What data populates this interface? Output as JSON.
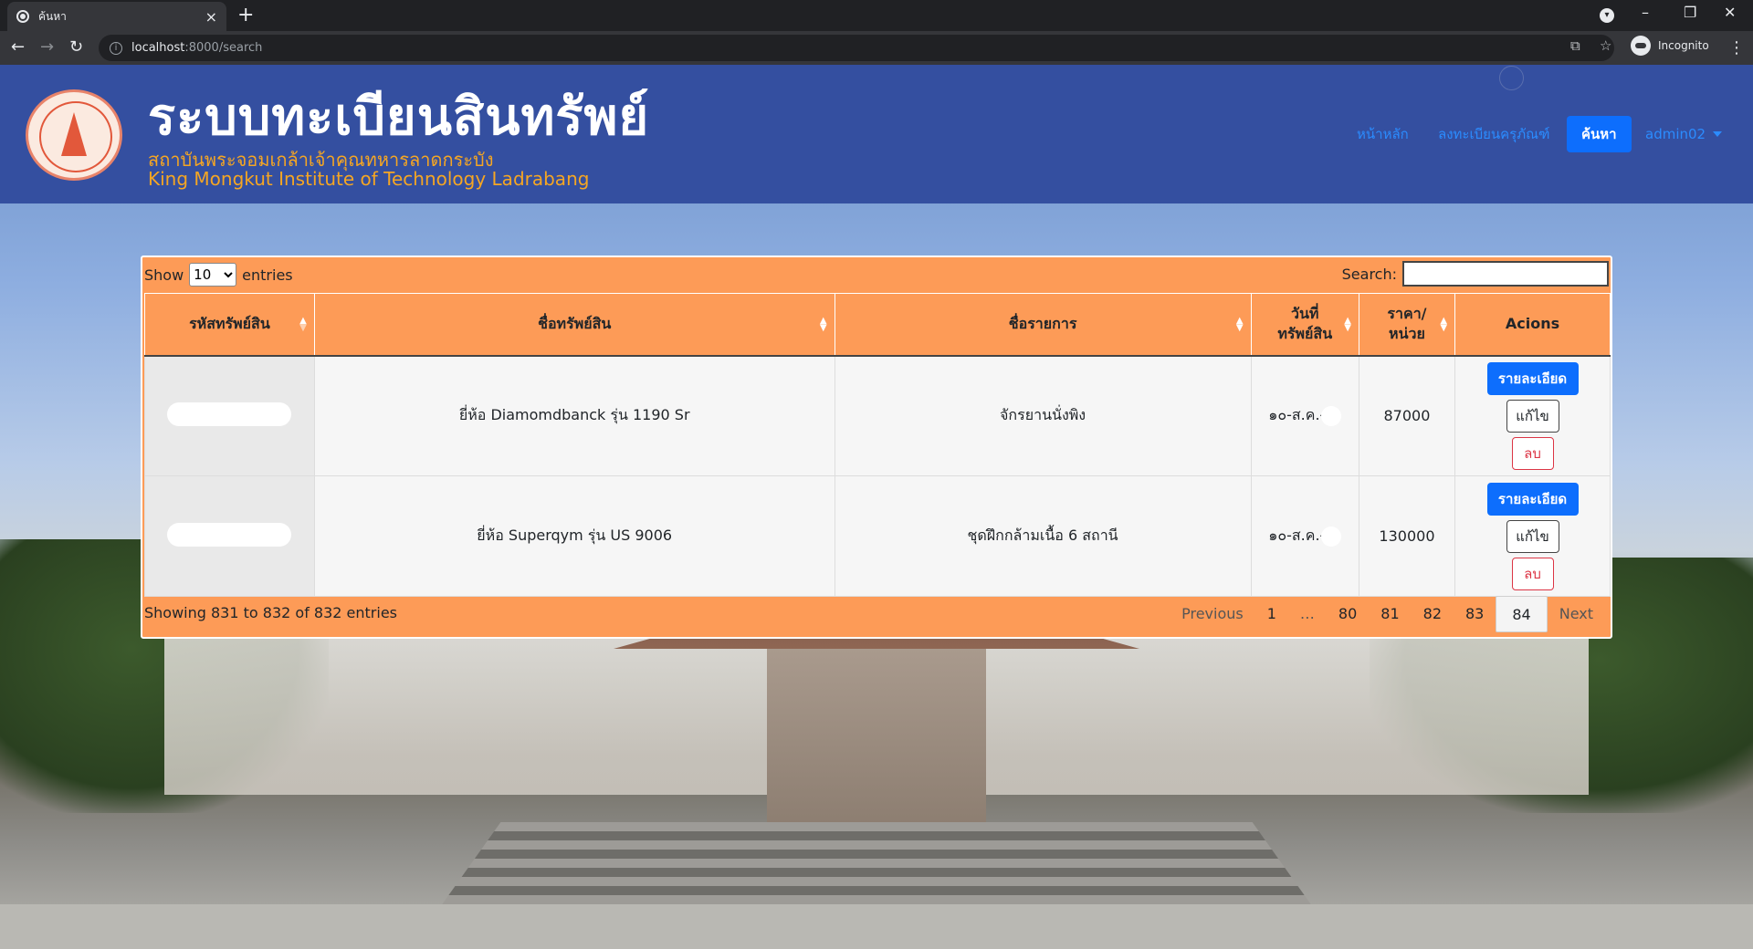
{
  "browser": {
    "tab_title": "ค้นหา",
    "tab_close": "×",
    "new_tab": "+",
    "url_host": "localhost",
    "url_path": ":8000/search",
    "profile": "Incognito"
  },
  "header": {
    "title": "ระบบทะเบียนสินทรัพย์",
    "subtitle_th": "สถาบันพระจอมเกล้าเจ้าคุณทหารลาดกระบัง",
    "subtitle_en": "King Mongkut Institute of Technology Ladrabang",
    "nav": {
      "home": "หน้าหลัก",
      "register": "ลงทะเบียนครุภัณฑ์",
      "search": "ค้นหา",
      "user": "admin02"
    }
  },
  "table_controls": {
    "show_label": "Show",
    "entries_label": "entries",
    "page_length": "10",
    "search_label": "Search:",
    "search_value": ""
  },
  "columns": [
    "รหัสทรัพย์สิน",
    "ชื่อทรัพย์สิน",
    "ชื่อรายการ",
    "วันที่ ทรัพย์สิน",
    "ราคา/ หน่วย",
    "Acions"
  ],
  "rows": [
    {
      "asset_name": "ยี่ห้อ Diamomdbanck รุ่น 1190 Sr",
      "item_name": "จักรยานนั่งพิง",
      "date": "๑๐-ส.ค.-",
      "price": "87000"
    },
    {
      "asset_name": "ยี่ห้อ Superqym รุ่น US 9006",
      "item_name": "ชุดฝึกกล้ามเนื้อ 6 สถานี",
      "date": "๑๐-ส.ค.-",
      "price": "130000"
    }
  ],
  "action_labels": {
    "detail": "รายละเอียด",
    "edit": "แก้ไข",
    "delete": "ลบ"
  },
  "footer": {
    "info": "Showing 831 to 832 of 832 entries",
    "previous": "Previous",
    "next": "Next",
    "pages": [
      "1",
      "…",
      "80",
      "81",
      "82",
      "83",
      "84"
    ],
    "current_page": "84"
  },
  "colors": {
    "header_bg": "#344fa0",
    "panel_bg": "#fd9b57",
    "accent_orange": "#f5a623",
    "primary_blue": "#0d6efd"
  }
}
